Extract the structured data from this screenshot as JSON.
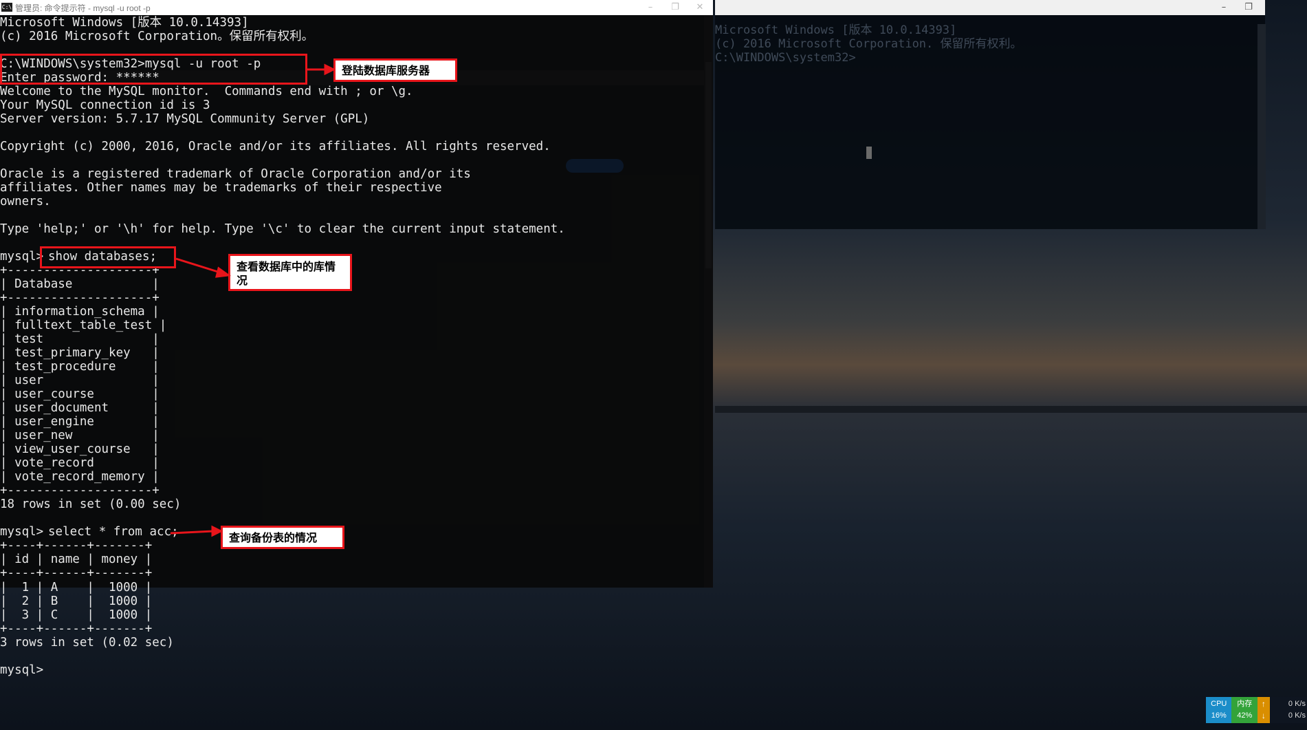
{
  "window": {
    "title": "管理员: 命令提示符 - mysql  -u root -p",
    "icon": "cmd-icon",
    "controls": [
      "–",
      "❐",
      "✕"
    ]
  },
  "background_console": {
    "lines": [
      "Microsoft Windows [版本 10.0.14393]",
      "(c) 2016 Microsoft Corporation. 保留所有权利。",
      "",
      "C:\\WINDOWS\\system32>"
    ]
  },
  "terminal": {
    "header_lines": [
      "Microsoft Windows [版本 10.0.14393]",
      "(c) 2016 Microsoft Corporation。保留所有权利。"
    ],
    "login_command": "C:\\WINDOWS\\system32>mysql -u root -p",
    "password_line": "Enter password: ******",
    "welcome_lines": [
      "Welcome to the MySQL monitor.  Commands end with ; or \\g.",
      "Your MySQL connection id is 3",
      "Server version: 5.7.17 MySQL Community Server (GPL)",
      "",
      "Copyright (c) 2000, 2016, Oracle and/or its affiliates. All rights reserved.",
      "",
      "Oracle is a registered trademark of Oracle Corporation and/or its",
      "affiliates. Other names may be trademarks of their respective",
      "owners.",
      "",
      "Type 'help;' or '\\h' for help. Type '\\c' to clear the current input statement."
    ],
    "prompt": "mysql>",
    "show_command": "show databases;",
    "db_table": {
      "border_top": "+--------------------+",
      "header": "| Database           |",
      "border_mid": "+--------------------+",
      "rows": [
        "| information_schema |",
        "| fulltext_table_test |",
        "| test               |",
        "| test_primary_key   |",
        "| test_procedure     |",
        "| user               |",
        "| user_course        |",
        "| user_document      |",
        "| user_engine        |",
        "| user_new           |",
        "| view_user_course   |",
        "| vote_record        |",
        "| vote_record_memory |"
      ],
      "border_bottom": "+--------------------+",
      "summary": "18 rows in set (0.00 sec)"
    },
    "select_command": "select * from acc;",
    "acc_table": {
      "border_top": "+----+------+-------+",
      "header": "| id | name | money |",
      "border_mid": "+----+------+-------+",
      "rows": [
        "|  1 | A    |  1000 |",
        "|  2 | B    |  1000 |",
        "|  3 | C    |  1000 |"
      ],
      "border_bottom": "+----+------+-------+",
      "summary": "3 rows in set (0.02 sec)"
    },
    "final_prompt": "mysql>"
  },
  "annotations": {
    "login": "登陆数据库服务器",
    "show": "查看数据库中的库情况",
    "select": "查询备份表的情况",
    "color": "#e8151b"
  },
  "stats": {
    "cpu_label": "CPU",
    "cpu_value": "16%",
    "mem_label": "内存",
    "mem_value": "42%",
    "up_arrow": "↑",
    "down_arrow": "↓",
    "up_speed": "0 K/s",
    "down_speed": "0 K/s"
  }
}
